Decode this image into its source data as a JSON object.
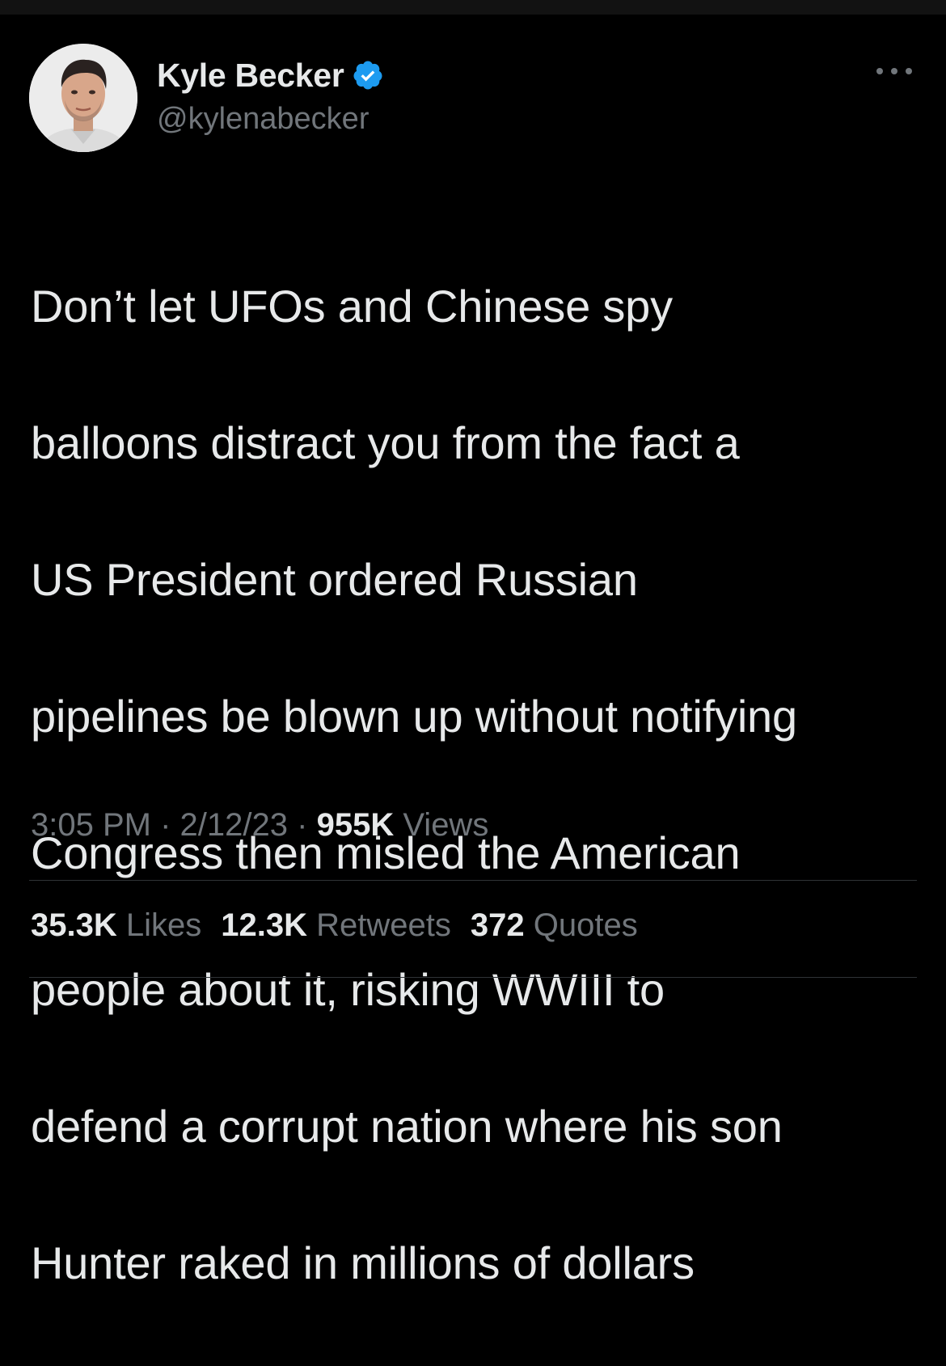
{
  "author": {
    "display_name": "Kyle Becker",
    "handle": "@kylenabecker",
    "verified": true,
    "verified_color": "#1d9bf0",
    "avatar_icon": "profile-photo"
  },
  "tweet": {
    "lines": [
      "Don’t let UFOs and Chinese spy",
      "balloons distract you from the fact a",
      "US President ordered Russian",
      "pipelines be blown up without notifying",
      "Congress then misled the American",
      "people about it, risking WWIII to",
      "defend a corrupt nation where his son",
      "Hunter raked in millions of dollars"
    ]
  },
  "meta": {
    "time": "3:05 PM",
    "separator": "·",
    "date": "2/12/23",
    "views_count": "955K",
    "views_label": "Views"
  },
  "stats": {
    "likes_count": "35.3K",
    "likes_label": "Likes",
    "retweets_count": "12.3K",
    "retweets_label": "Retweets",
    "quotes_count": "372",
    "quotes_label": "Quotes"
  },
  "colors": {
    "background": "#000000",
    "text_primary": "#e7e9ea",
    "text_secondary": "#71767b",
    "divider": "#2f3336"
  }
}
